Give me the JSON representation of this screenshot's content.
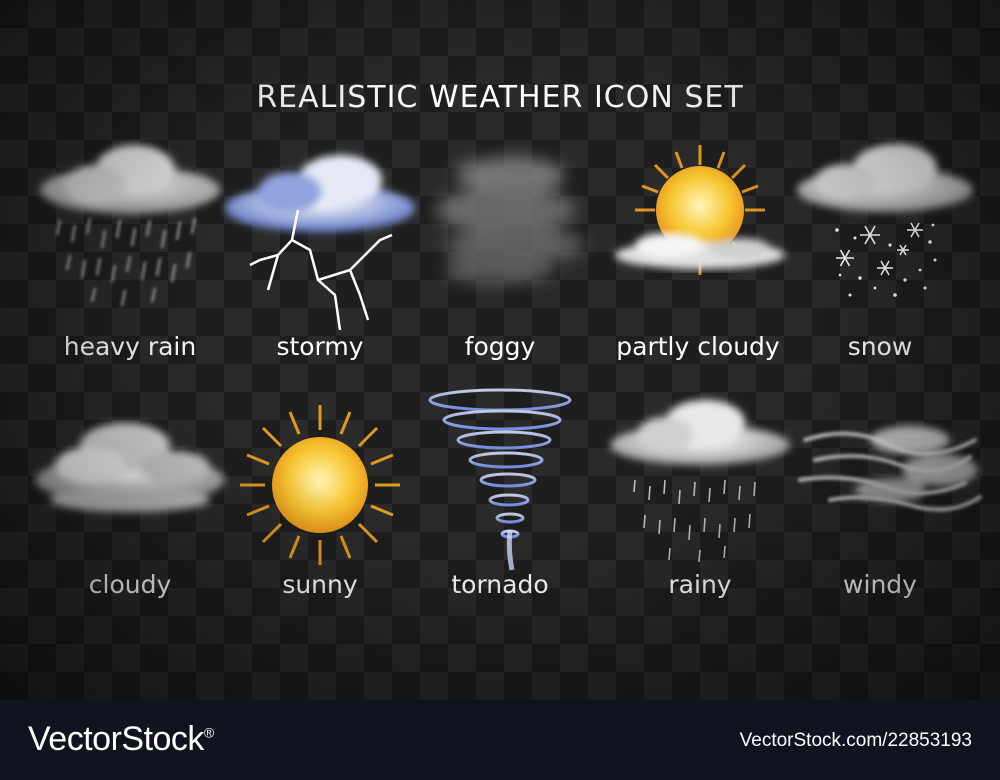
{
  "title": "REALISTIC WEATHER ICON SET",
  "icons": [
    {
      "label": "heavy rain",
      "icon": "heavy-rain-icon"
    },
    {
      "label": "stormy",
      "icon": "storm-icon"
    },
    {
      "label": "foggy",
      "icon": "fog-icon"
    },
    {
      "label": "partly cloudy",
      "icon": "partly-cloudy-icon"
    },
    {
      "label": "snow",
      "icon": "snow-icon"
    },
    {
      "label": "cloudy",
      "icon": "cloud-icon"
    },
    {
      "label": "sunny",
      "icon": "sun-icon"
    },
    {
      "label": "tornado",
      "icon": "tornado-icon"
    },
    {
      "label": "rainy",
      "icon": "rain-icon"
    },
    {
      "label": "windy",
      "icon": "wind-icon"
    }
  ],
  "footer": {
    "brand": "VectorStock",
    "registered_mark": "®",
    "stock_id": "VectorStock.com/22853193"
  },
  "colors": {
    "background": "#1e1e1e",
    "checker": "#2b2b2b",
    "footer": "#10141f",
    "sun": "#f7c733",
    "lightning": "#bfcaff"
  }
}
